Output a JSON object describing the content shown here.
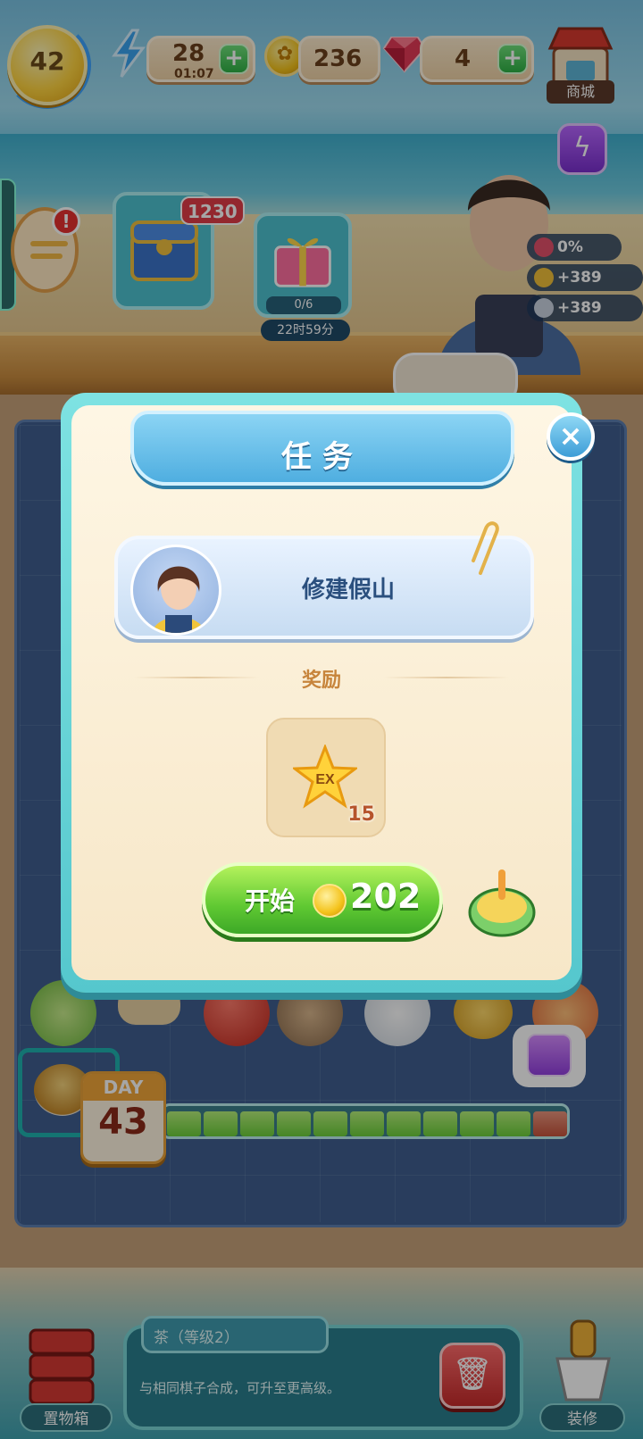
{
  "hud": {
    "level": "42",
    "energy_count": "28",
    "energy_timer": "01:07",
    "coins": "236",
    "gems": "4",
    "shop_label": "商城"
  },
  "scene": {
    "chest_badge": "1230",
    "gift_progress": "0/6",
    "gift_timer": "22时59分",
    "stats": [
      {
        "value": "0%"
      },
      {
        "value": "+389"
      },
      {
        "value": "+389"
      }
    ]
  },
  "dialog": {
    "title": "任务",
    "task_name": "修建假山",
    "reward_label": "奖励",
    "reward_icon_text": "EX",
    "reward_qty": "15",
    "start_label": "开始",
    "start_price": "202"
  },
  "board": {
    "day_label": "DAY",
    "day_number": "43",
    "progress_filled": 10,
    "progress_total": 11
  },
  "bottom": {
    "item_title": "茶（等级2）",
    "item_desc": "与相同棋子合成，可升至更高级。",
    "storage_label": "置物箱",
    "decorate_label": "装修"
  }
}
